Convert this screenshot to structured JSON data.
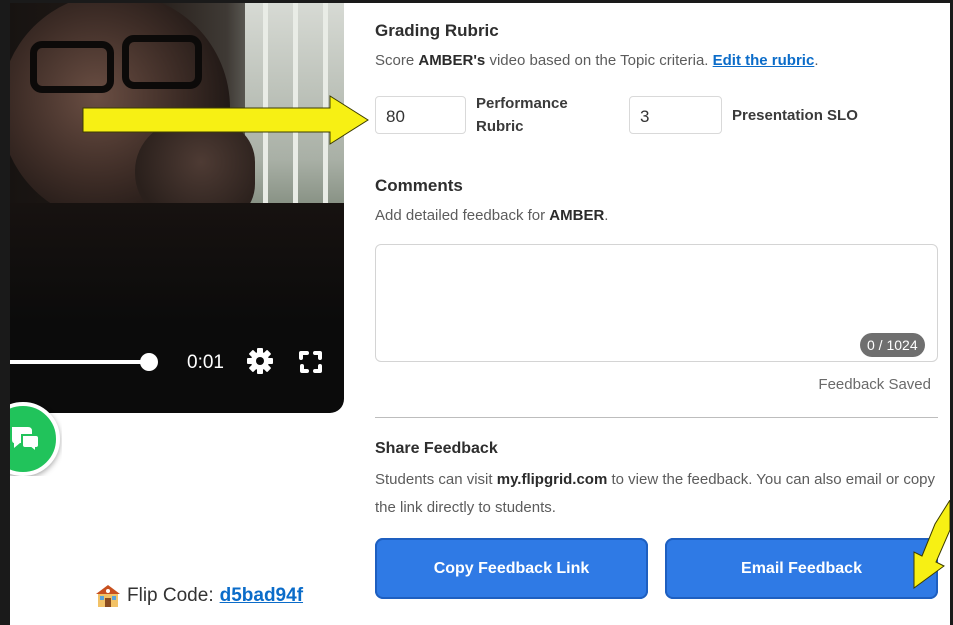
{
  "video": {
    "time": "0:01",
    "progress": 0.45
  },
  "flip_code": {
    "label": "Flip Code:",
    "code": "d5bad94f"
  },
  "rubric": {
    "title": "Grading Rubric",
    "sub_prefix": "Score ",
    "student": "AMBER's",
    "sub_mid": " video based on the Topic criteria. ",
    "edit_link": "Edit the rubric",
    "sub_end": ".",
    "criteria": [
      {
        "value": "80",
        "label_line1": "Performance",
        "label_line2": "Rubric"
      },
      {
        "value": "3",
        "label": "Presentation SLO"
      }
    ]
  },
  "comments": {
    "title": "Comments",
    "sub_prefix": "Add detailed feedback for ",
    "student": "AMBER",
    "sub_end": ".",
    "value": "",
    "counter": "0 / 1024",
    "status": "Feedback Saved"
  },
  "share": {
    "title": "Share Feedback",
    "text_prefix": "Students can visit ",
    "site": "my.flipgrid.com",
    "text_suffix": " to view the feedback. You can also email or copy the link directly to students.",
    "copy_button": "Copy Feedback Link",
    "email_button": "Email Feedback"
  },
  "colors": {
    "accent": "#2f7ae5",
    "link": "#0b6cc9",
    "chat_green": "#21c35b",
    "arrow_yellow": "#f7f014"
  },
  "icons": [
    "gear-icon",
    "fullscreen-icon",
    "chat-icon",
    "school-house-icon",
    "arrow-annotation"
  ]
}
